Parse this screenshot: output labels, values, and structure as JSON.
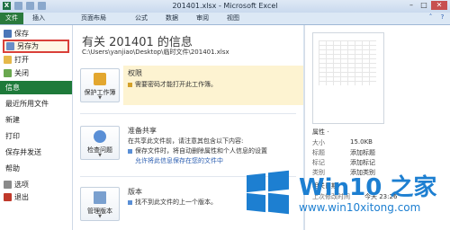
{
  "titlebar": {
    "title": "201401.xlsx - Microsoft Excel",
    "minimize": "–",
    "maximize": "□",
    "close": "✕"
  },
  "tabs": [
    "文件",
    "插入",
    "页面布局",
    "公式",
    "数据",
    "审阅",
    "视图"
  ],
  "nav": {
    "save": "保存",
    "save_as": "另存为",
    "open": "打开",
    "close": "关闭",
    "info": "信息",
    "recent": "最近所用文件",
    "new": "新建",
    "print": "打印",
    "save_send": "保存并发送",
    "help": "帮助",
    "options": "选项",
    "exit": "退出"
  },
  "main": {
    "title": "有关 201401 的信息",
    "path": "C:\\Users\\yanjiao\\Desktop\\临时文件\\201401.xlsx",
    "permissions": {
      "button": "保护工作簿",
      "heading": "权限",
      "line1": "需要密码才能打开此工作簿。"
    },
    "prepare": {
      "button": "检查问题",
      "heading": "准备共享",
      "line1": "在共享此文件前，请注意其包含以下内容:",
      "line2": "保存文件时，将自动删除属性和个人信息的设置",
      "line3": "允许将此信息保存在您的文件中"
    },
    "versions": {
      "button": "管理版本",
      "heading": "版本",
      "line1": "找不到此文件的上一个版本。"
    }
  },
  "pane": {
    "properties": "属性 ·",
    "rows": [
      {
        "k": "大小",
        "v": "15.0KB"
      },
      {
        "k": "标题",
        "v": "添加标题"
      },
      {
        "k": "标记",
        "v": "添加标记"
      },
      {
        "k": "类别",
        "v": "添加类别"
      }
    ],
    "related_dates": "相关日期",
    "modified": {
      "k": "上次修改时间",
      "v": "今天 23:26"
    }
  },
  "watermark": {
    "title": "Win10 之家",
    "url": "www.win10xitong.com"
  },
  "colors": {
    "file_tab": "#2a7a3d",
    "info_active": "#1e7a3a",
    "highlight_border": "#d9403a",
    "win_blue": "#1d7fd1"
  }
}
